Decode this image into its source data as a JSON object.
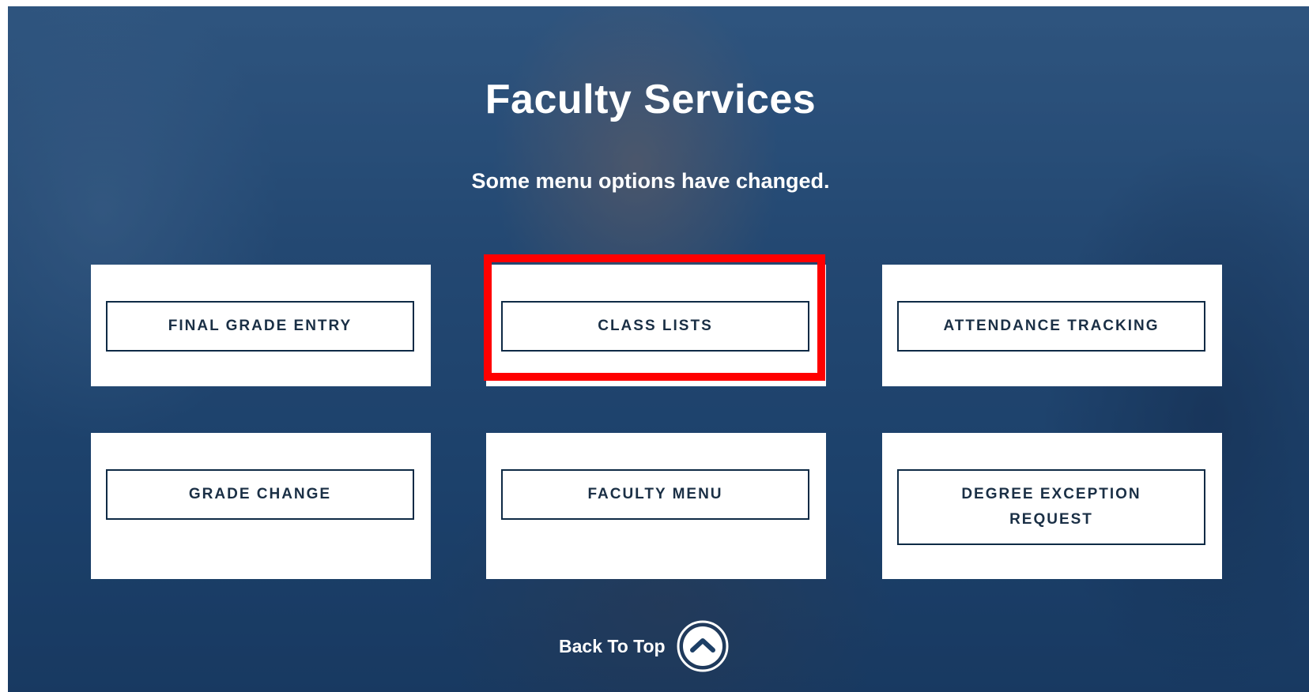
{
  "header": {
    "title": "Faculty Services",
    "subtitle": "Some menu options have changed."
  },
  "cards": [
    {
      "label": "FINAL GRADE ENTRY"
    },
    {
      "label": "CLASS LISTS"
    },
    {
      "label": "ATTENDANCE TRACKING"
    },
    {
      "label": "GRADE CHANGE"
    },
    {
      "label": "FACULTY MENU"
    },
    {
      "label": "DEGREE EXCEPTION REQUEST"
    }
  ],
  "footer": {
    "back_to_top_label": "Back To Top",
    "back_to_top_icon": "chevron-up-circle-icon"
  },
  "colors": {
    "hero_background": "#2c5580",
    "card_background": "#ffffff",
    "button_border": "#0e2a45",
    "button_text": "#1a2f45",
    "highlight": "#ff0000"
  }
}
